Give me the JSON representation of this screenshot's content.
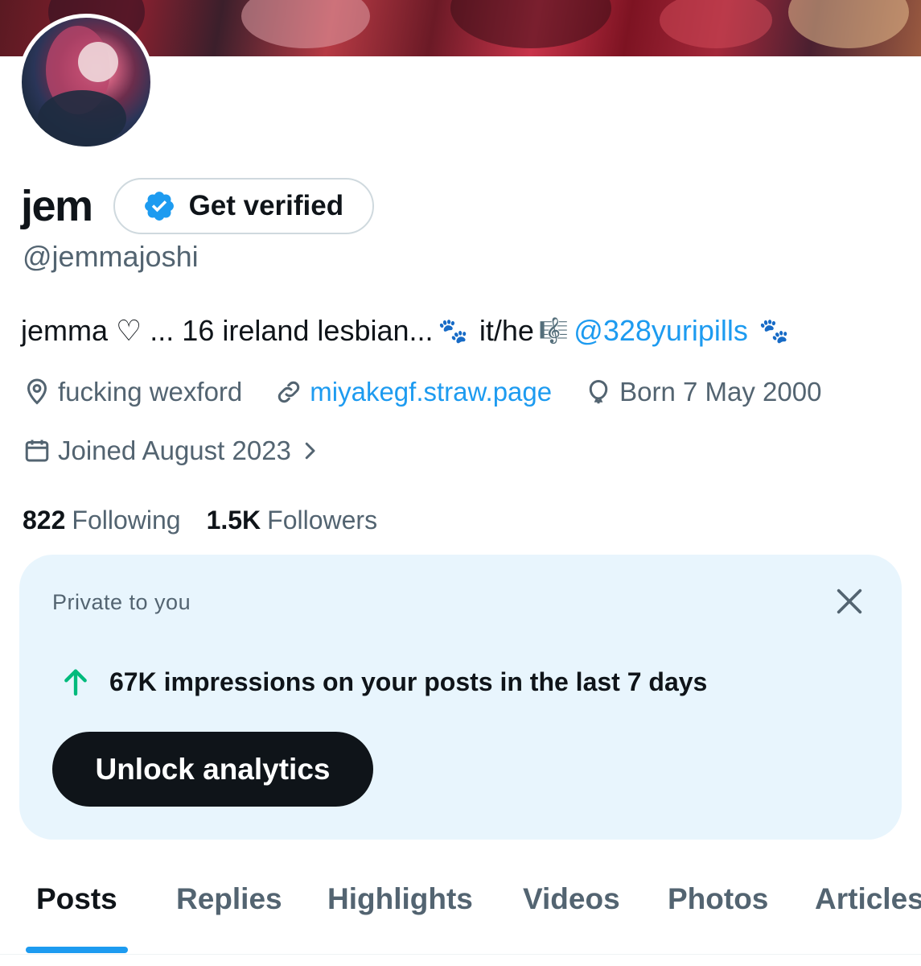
{
  "profile": {
    "display_name": "jem",
    "handle": "@jemmajoshi",
    "verify_label": "Get verified",
    "bio": {
      "text_part1": "jemma ♡ ... 16 ireland lesbian...",
      "paw_glyph": "🐾",
      "text_part2": "it/he",
      "music_glyph": "🎼",
      "mention": "@328yuripills",
      "paw_glyph_end": "🐾"
    },
    "location": "fucking wexford",
    "website": "miyakegf.straw.page",
    "born": "Born 7 May 2000",
    "joined": "Joined August 2023",
    "following_count": "822",
    "following_label": "Following",
    "followers_count": "1.5K",
    "followers_label": "Followers"
  },
  "private_card": {
    "title": "Private to you",
    "stat_text": "67K impressions on your posts in the last 7 days",
    "button_label": "Unlock analytics"
  },
  "tabs": [
    "Posts",
    "Replies",
    "Highlights",
    "Videos",
    "Photos",
    "Articles"
  ],
  "active_tab": "Posts",
  "icons": {
    "verify": "verified-badge-icon",
    "location": "location-pin-icon",
    "link": "link-icon",
    "birthday": "balloon-icon",
    "joined": "calendar-icon",
    "chevron": "chevron-right-icon",
    "close": "close-icon",
    "trend": "arrow-up-icon"
  },
  "colors": {
    "accent": "#1d9bf0",
    "text_primary": "#0f1419",
    "text_secondary": "#536471",
    "card_bg": "#e8f5fd",
    "trend_green": "#00ba7c"
  }
}
